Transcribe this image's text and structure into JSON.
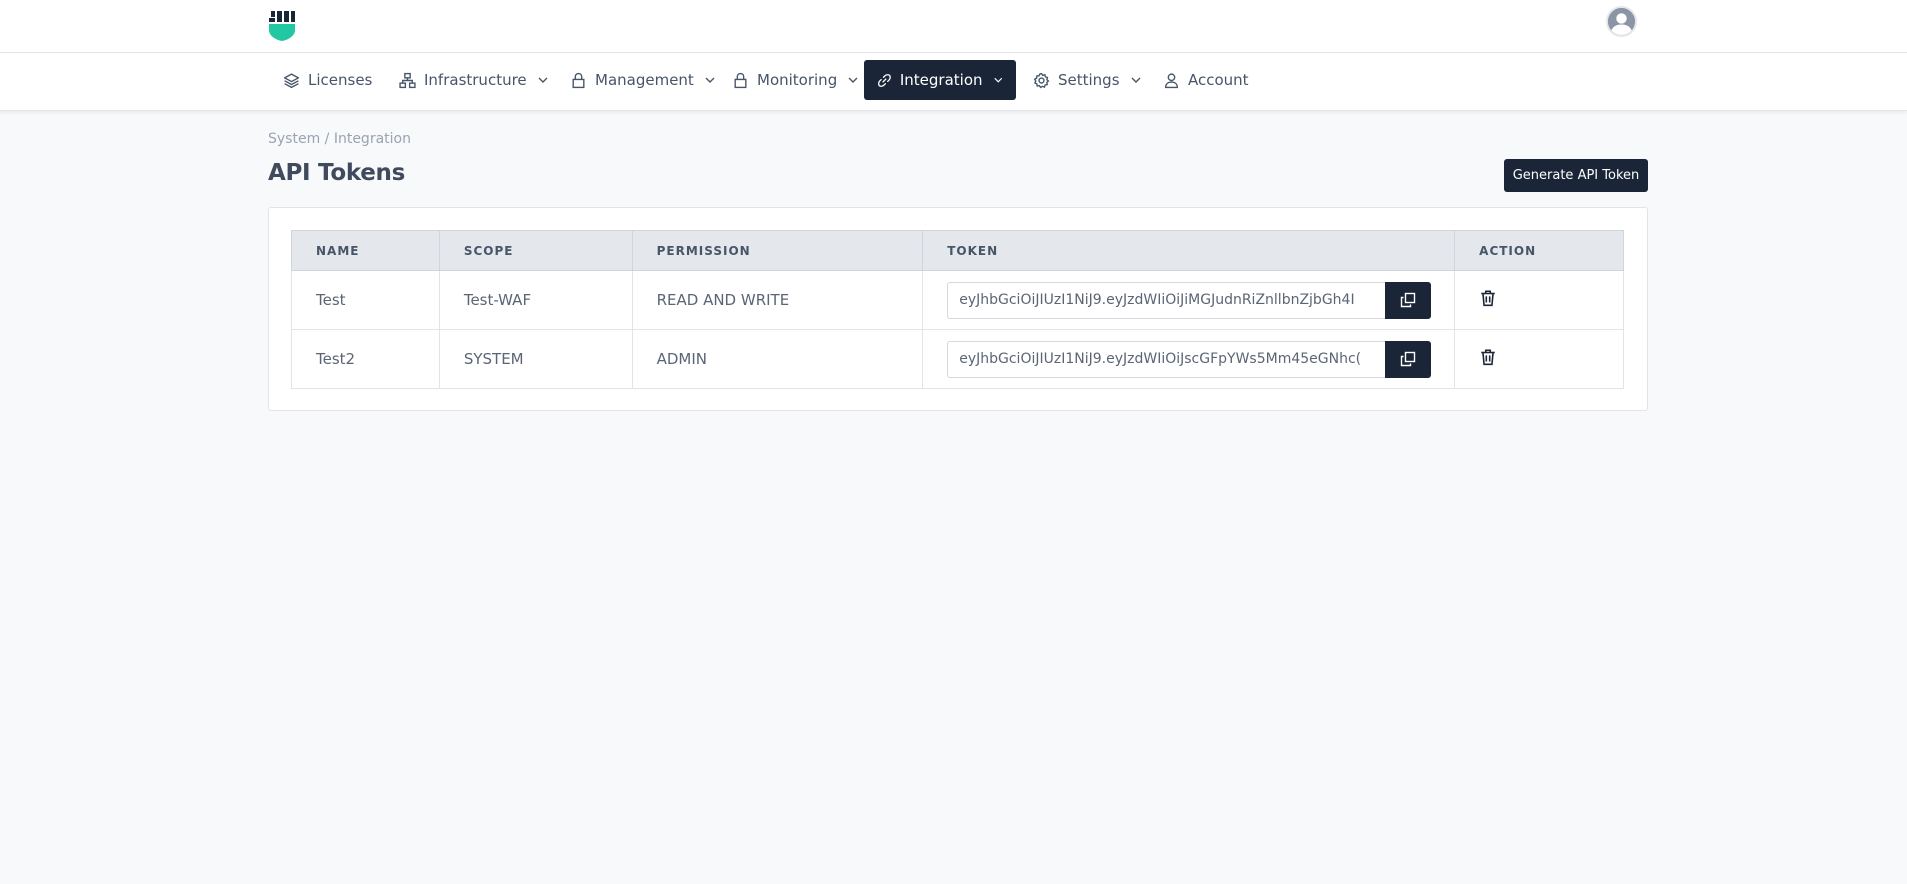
{
  "header": {
    "logo_icon": "shield-logo-icon",
    "avatar_icon": "user-avatar-icon"
  },
  "nav": {
    "items": [
      {
        "label": "Licenses",
        "icon": "layers-icon",
        "has_dropdown": false
      },
      {
        "label": "Infrastructure",
        "icon": "network-icon",
        "has_dropdown": true
      },
      {
        "label": "Management",
        "icon": "lock-icon",
        "has_dropdown": true
      },
      {
        "label": "Monitoring",
        "icon": "lock-icon",
        "has_dropdown": true
      },
      {
        "label": "Integration",
        "icon": "link-icon",
        "has_dropdown": true,
        "active": true
      },
      {
        "label": "Settings",
        "icon": "gear-icon",
        "has_dropdown": true
      },
      {
        "label": "Account",
        "icon": "user-icon",
        "has_dropdown": false
      }
    ]
  },
  "breadcrumb": "System / Integration",
  "page_title": "API Tokens",
  "generate_button_label": "Generate API Token",
  "table": {
    "columns": [
      "NAME",
      "SCOPE",
      "PERMISSION",
      "TOKEN",
      "ACTION"
    ],
    "rows": [
      {
        "name": "Test",
        "scope": "Test-WAF",
        "permission": "READ AND WRITE",
        "token": "eyJhbGciOiJIUzI1NiJ9.eyJzdWIiOiJiMGJudnRiZnllbnZjbGh4I"
      },
      {
        "name": "Test2",
        "scope": "SYSTEM",
        "permission": "ADMIN",
        "token": "eyJhbGciOiJIUzI1NiJ9.eyJzdWIiOiJscGFpYWs5Mm45eGNhc("
      }
    ]
  },
  "colors": {
    "accent_dark": "#1b2538",
    "logo_teal": "#22c7a4",
    "background": "#f8f9fb"
  }
}
